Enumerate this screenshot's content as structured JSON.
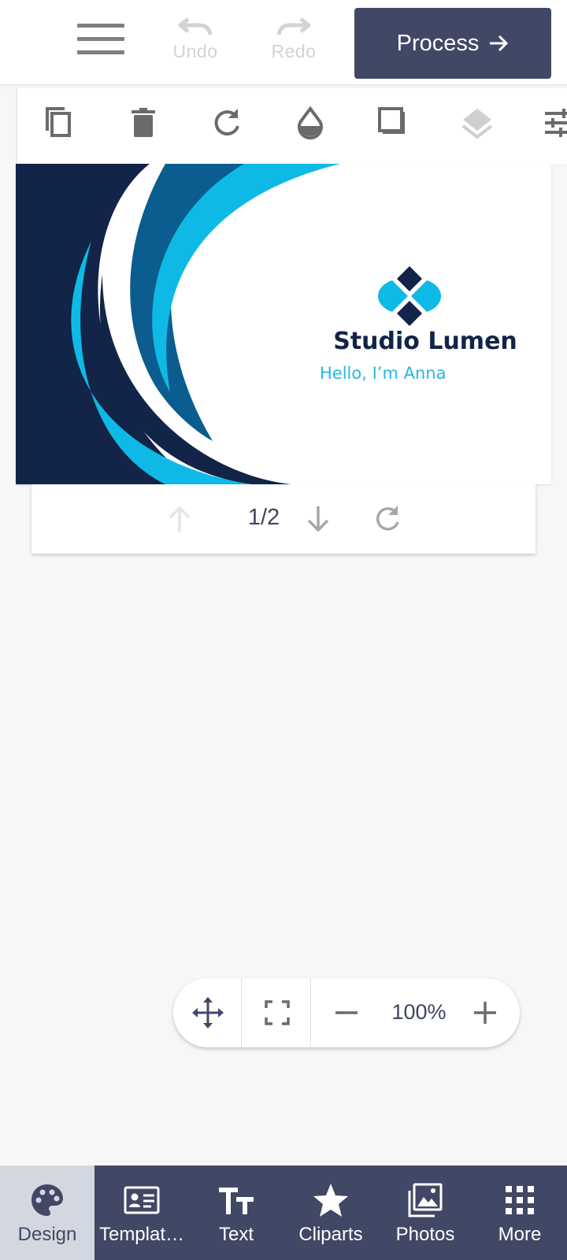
{
  "header": {
    "undo_label": "Undo",
    "redo_label": "Redo",
    "process_label": "Process",
    "process_color": "#414866"
  },
  "toolbar": {
    "icons": [
      "copy-icon",
      "trash-icon",
      "rotate-icon",
      "opacity-drop-icon",
      "shadow-square-icon",
      "layers-icon",
      "settings-sliders-icon"
    ]
  },
  "card": {
    "title": "Studio Lumen",
    "subtitle": "Hello, I’m Anna",
    "colors": {
      "navy": "#122448",
      "mid_blue": "#0a5d8e",
      "cyan": "#0fb9e6",
      "white": "#ffffff"
    }
  },
  "pager": {
    "indicator": "1/2"
  },
  "zoom": {
    "value": "100%"
  },
  "bottom_nav": {
    "items": [
      {
        "label": "Design",
        "icon": "palette-icon",
        "active": true
      },
      {
        "label": "Templat…",
        "icon": "id-card-icon",
        "active": false
      },
      {
        "label": "Text",
        "icon": "text-tt-icon",
        "active": false
      },
      {
        "label": "Cliparts",
        "icon": "star-icon",
        "active": false
      },
      {
        "label": "Photos",
        "icon": "photos-icon",
        "active": false
      },
      {
        "label": "More",
        "icon": "grid-icon",
        "active": false
      }
    ]
  }
}
